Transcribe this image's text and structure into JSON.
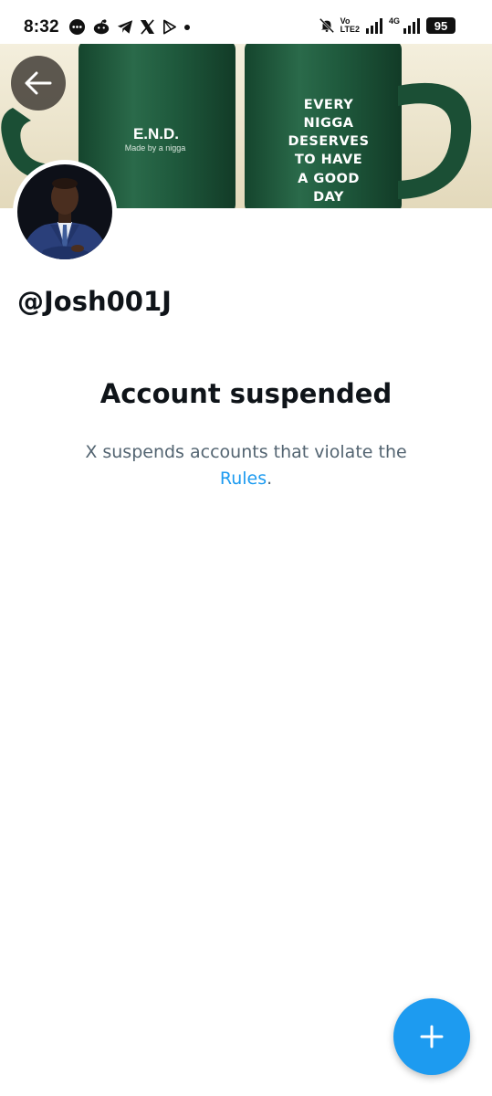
{
  "status_bar": {
    "time": "8:32",
    "volte_line1": "Vo",
    "volte_line2": "LTE2",
    "network_label": "4G",
    "battery": "95",
    "icons": [
      "message-icon",
      "reddit-icon",
      "telegram-icon",
      "x-icon",
      "play-icon",
      "dot-icon",
      "mute-icon",
      "signal-icon",
      "signal-icon"
    ]
  },
  "banner": {
    "left_mug_brand": "E.N.D.",
    "left_mug_sub": "Made by a nigga",
    "right_mug_lines": [
      "EVERY",
      "NIGGA",
      "DESERVES",
      "TO HAVE",
      "A GOOD",
      "DAY"
    ],
    "mug_color": "#1f5a3d"
  },
  "profile": {
    "handle": "@Josh001J"
  },
  "suspended": {
    "title": "Account suspended",
    "text_before": "X suspends accounts that violate the",
    "link": "Rules",
    "text_after": "."
  },
  "colors": {
    "accent": "#1d9bf0",
    "text_primary": "#0f1419",
    "text_secondary": "#536471"
  },
  "fab": {
    "icon": "plus-icon"
  }
}
